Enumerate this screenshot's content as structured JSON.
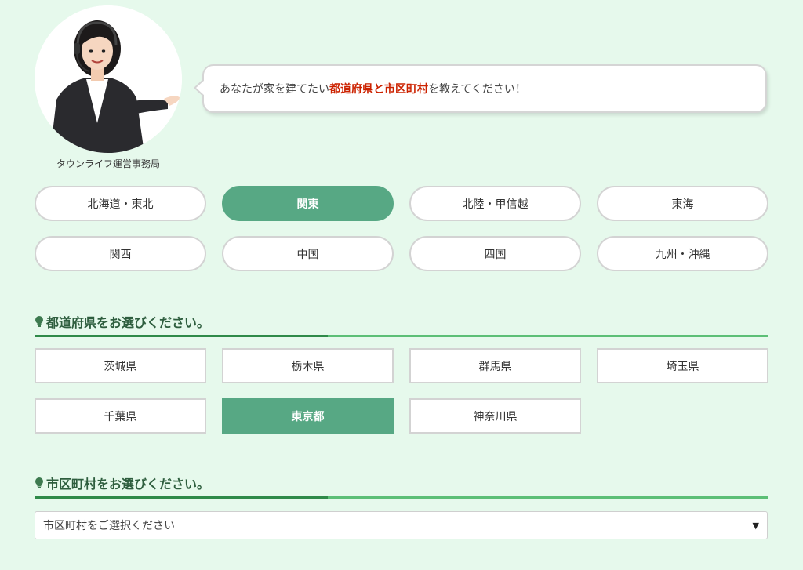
{
  "operator": {
    "caption": "タウンライフ運営事務局"
  },
  "bubble": {
    "text_before": "あなたが家を建てたい",
    "highlight": "都道府県と市区町村",
    "text_after": "を教えてください！"
  },
  "regions": [
    {
      "label": "北海道・東北",
      "selected": false
    },
    {
      "label": "関東",
      "selected": true
    },
    {
      "label": "北陸・甲信越",
      "selected": false
    },
    {
      "label": "東海",
      "selected": false
    },
    {
      "label": "関西",
      "selected": false
    },
    {
      "label": "中国",
      "selected": false
    },
    {
      "label": "四国",
      "selected": false
    },
    {
      "label": "九州・沖縄",
      "selected": false
    }
  ],
  "prefecture_section": {
    "title": "都道府県をお選びください。",
    "items": [
      {
        "label": "茨城県",
        "selected": false
      },
      {
        "label": "栃木県",
        "selected": false
      },
      {
        "label": "群馬県",
        "selected": false
      },
      {
        "label": "埼玉県",
        "selected": false
      },
      {
        "label": "千葉県",
        "selected": false
      },
      {
        "label": "東京都",
        "selected": true
      },
      {
        "label": "神奈川県",
        "selected": false
      }
    ]
  },
  "city_section": {
    "title": "市区町村をお選びください。",
    "select_value": "市区町村をご選択ください"
  },
  "colors": {
    "accent": "#57a884",
    "background": "#e6f9ec",
    "highlight": "#cc2200"
  }
}
